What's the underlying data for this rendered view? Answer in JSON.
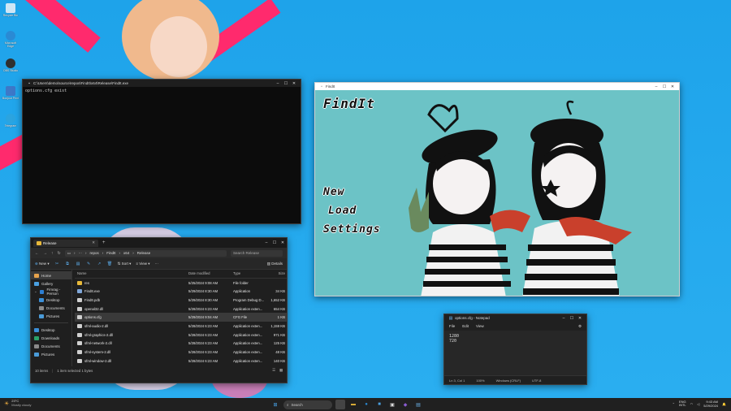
{
  "desktop": {
    "icons": [
      {
        "label": "Recycle Bin",
        "color": "#cfe6f5"
      },
      {
        "label": "Microsoft Edge",
        "color": "#2a8ad4"
      },
      {
        "label": "OBS Studio",
        "color": "#303030"
      },
      {
        "label": "Bonjour Print",
        "color": "#3d78c8"
      },
      {
        "label": "Telegram",
        "color": "#2ba4e0"
      }
    ]
  },
  "terminal": {
    "title": "C:\\Users\\demo\\source\\repos\\FindIt\\x64\\Release\\FindIt.exe",
    "output": "options.cfg exist"
  },
  "explorer": {
    "tab_title": "Release",
    "breadcrumb": [
      "repos",
      "FindIt",
      "x64",
      "Release"
    ],
    "search_placeholder": "Search Release",
    "toolbar": {
      "new": "New",
      "sort": "Sort",
      "view": "View",
      "details": "Details"
    },
    "sidebar": {
      "home": "Home",
      "gallery": "Gallery",
      "onedrive": "Fimrag - Person",
      "desktop": "Desktop",
      "documents": "Documents",
      "pictures": "Pictures",
      "desktop2": "Desktop",
      "downloads": "Downloads",
      "documents2": "Documents",
      "pictures2": "Pictures"
    },
    "columns": {
      "name": "Name",
      "date": "Date modified",
      "type": "Type",
      "size": "Size"
    },
    "files": [
      {
        "name": "res",
        "date": "5/25/2024 9:08 AM",
        "type": "File folder",
        "size": "",
        "kind": "folder"
      },
      {
        "name": "FindIt.exe",
        "date": "5/29/2024 8:30 AM",
        "type": "Application",
        "size": "34 KB",
        "kind": "exe"
      },
      {
        "name": "FindIt.pdb",
        "date": "5/29/2024 8:30 AM",
        "type": "Program Debug D...",
        "size": "1,652 KB",
        "kind": "file"
      },
      {
        "name": "openal32.dll",
        "date": "5/28/2024 6:23 AM",
        "type": "Application exten...",
        "size": "654 KB",
        "kind": "file"
      },
      {
        "name": "options.cfg",
        "date": "5/29/2024 9:04 AM",
        "type": "CFG File",
        "size": "1 KB",
        "kind": "file"
      },
      {
        "name": "sfml-audio-2.dll",
        "date": "5/28/2024 6:23 AM",
        "type": "Application exten...",
        "size": "1,159 KB",
        "kind": "file"
      },
      {
        "name": "sfml-graphics-2.dll",
        "date": "5/28/2024 6:23 AM",
        "type": "Application exten...",
        "size": "971 KB",
        "kind": "file"
      },
      {
        "name": "sfml-network-2.dll",
        "date": "5/28/2024 6:23 AM",
        "type": "Application exten...",
        "size": "125 KB",
        "kind": "file"
      },
      {
        "name": "sfml-system-2.dll",
        "date": "5/28/2024 6:23 AM",
        "type": "Application exten...",
        "size": "48 KB",
        "kind": "file"
      },
      {
        "name": "sfml-window-2.dll",
        "date": "5/28/2024 6:23 AM",
        "type": "Application exten...",
        "size": "140 KB",
        "kind": "file"
      }
    ],
    "status": {
      "items": "10 items",
      "selected": "1 item selected  1 bytes"
    }
  },
  "findit": {
    "title": "FindIt",
    "logo": "FindIt",
    "menu": [
      "New",
      "Load",
      "Settings"
    ]
  },
  "notepad": {
    "title": "options.cfg - Notepad",
    "menu": [
      "File",
      "Edit",
      "View"
    ],
    "content": "1280\n720",
    "status": {
      "pos": "Ln 3, Col 1",
      "zoom": "100%",
      "eol": "Windows (CRLF)",
      "enc": "UTF-8"
    }
  },
  "taskbar": {
    "weather": {
      "temp": "23°C",
      "desc": "Mostly cloudy"
    },
    "search": "Search",
    "lang": "ENG",
    "lang2": "INTL",
    "time": "9:43 AM",
    "date": "5/29/2024"
  }
}
